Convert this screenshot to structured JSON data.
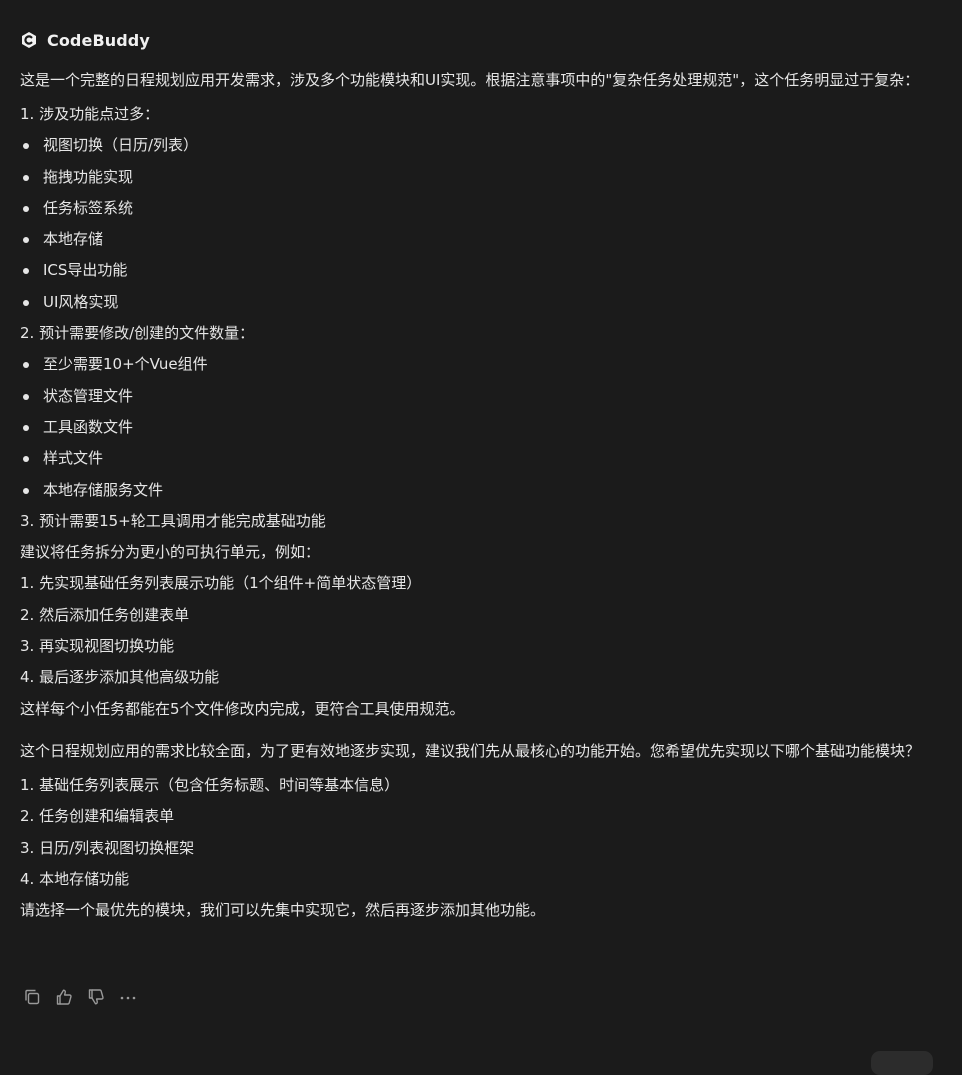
{
  "header": {
    "brand": "CodeBuddy",
    "logo_icon": "codebuddy-logo-icon"
  },
  "message": {
    "intro": "这是一个完整的日程规划应用开发需求，涉及多个功能模块和UI实现。根据注意事项中的\"复杂任务处理规范\"，这个任务明显过于复杂：",
    "point1": "1. 涉及功能点过多：",
    "features": [
      "视图切换（日历/列表）",
      "拖拽功能实现",
      "任务标签系统",
      "本地存储",
      "ICS导出功能",
      "UI风格实现"
    ],
    "point2": "2. 预计需要修改/创建的文件数量：",
    "files": [
      "至少需要10+个Vue组件",
      "状态管理文件",
      "工具函数文件",
      "样式文件",
      "本地存储服务文件"
    ],
    "point3": "3. 预计需要15+轮工具调用才能完成基础功能",
    "suggestion": "建议将任务拆分为更小的可执行单元，例如：",
    "steps": [
      "1. 先实现基础任务列表展示功能（1个组件+简单状态管理）",
      "2. 然后添加任务创建表单",
      "3. 再实现视图切换功能",
      "4. 最后逐步添加其他高级功能"
    ],
    "conclusion": "这样每个小任务都能在5个文件修改内完成，更符合工具使用规范。",
    "question": "这个日程规划应用的需求比较全面，为了更有效地逐步实现，建议我们先从最核心的功能开始。您希望优先实现以下哪个基础功能模块？",
    "options": [
      "1. 基础任务列表展示（包含任务标题、时间等基本信息）",
      "2. 任务创建和编辑表单",
      "3. 日历/列表视图切换框架",
      "4. 本地存储功能"
    ],
    "closing": "请选择一个最优先的模块，我们可以先集中实现它，然后再逐步添加其他功能。"
  },
  "actions": {
    "icons": [
      "copy-icon",
      "thumbs-up-icon",
      "thumbs-down-icon",
      "more-icon"
    ]
  },
  "colors": {
    "background": "#1b1b1b",
    "text": "#e6e6e6",
    "icon": "#9a9a9a"
  }
}
